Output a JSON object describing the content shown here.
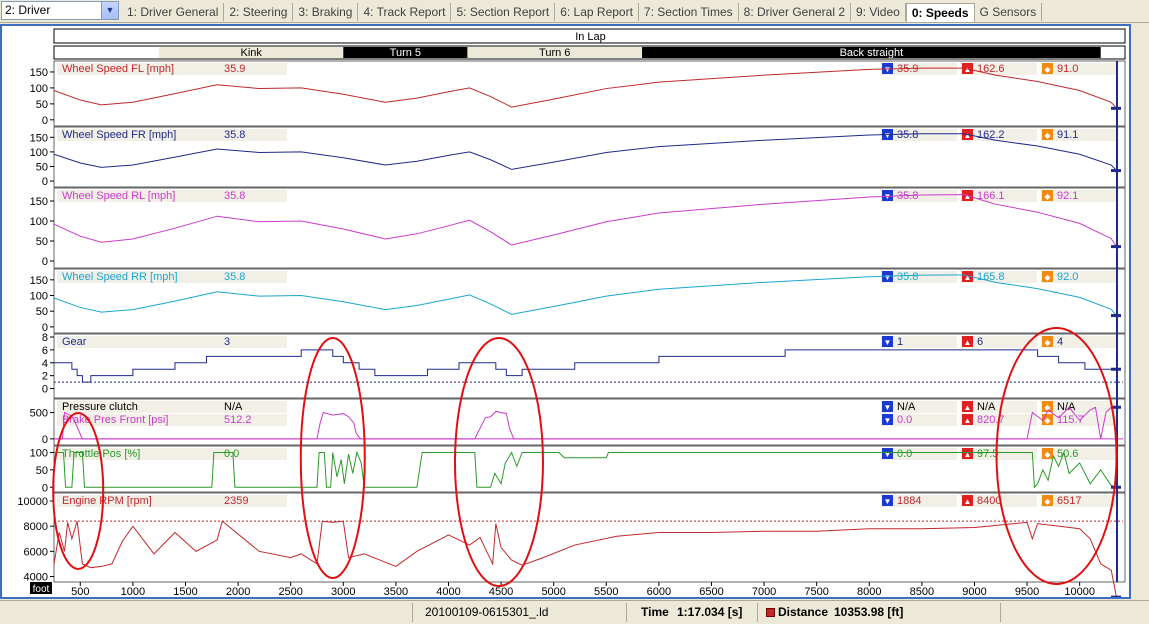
{
  "driver_select": {
    "value": "2: Driver"
  },
  "tabs": [
    {
      "label": "1: Driver General"
    },
    {
      "label": "2: Steering"
    },
    {
      "label": "3: Braking"
    },
    {
      "label": "4: Track Report"
    },
    {
      "label": "5: Section Report"
    },
    {
      "label": "6: Lap Report"
    },
    {
      "label": "7: Section Times"
    },
    {
      "label": "8: Driver General 2"
    },
    {
      "label": "9: Video"
    },
    {
      "label": "0: Speeds",
      "active": true
    },
    {
      "label": "G Sensors"
    }
  ],
  "lap_label": "In Lap",
  "sections": [
    {
      "label": "Kink",
      "dark": false,
      "from": 1250,
      "to": 3000
    },
    {
      "label": "Turn 5",
      "dark": true,
      "from": 3000,
      "to": 4180
    },
    {
      "label": "Turn 6",
      "dark": false,
      "from": 4180,
      "to": 5840
    },
    {
      "label": "Back straight",
      "dark": true,
      "from": 5840,
      "to": 10200
    }
  ],
  "colors": {
    "fl": "#c0282c",
    "fr": "#1f2a8c",
    "rl": "#cc3acc",
    "rr": "#1aa6d0",
    "gear": "#1f2a8c",
    "clutch": "#000000",
    "brake": "#cc3acc",
    "throttle": "#2a9a2a",
    "rpm": "#c0282c",
    "min_icon": "#1a3ad0",
    "max_icon": "#e02020",
    "avg_icon": "#f08a10",
    "cursor": "#1f2a8c",
    "ellipse": "#e01010",
    "frame": "#3c6fc4"
  },
  "panels": [
    {
      "key": "fl",
      "channels": [
        {
          "name": "Wheel Speed FL [mph]",
          "value": "35.9",
          "min": "35.9",
          "max": "162.6",
          "avg": "91.0"
        }
      ],
      "ticks": [
        "150",
        "100",
        "50",
        "0"
      ]
    },
    {
      "key": "fr",
      "channels": [
        {
          "name": "Wheel Speed FR [mph]",
          "value": "35.8",
          "min": "35.8",
          "max": "162.2",
          "avg": "91.1"
        }
      ],
      "ticks": [
        "150",
        "100",
        "50",
        "0"
      ]
    },
    {
      "key": "rl",
      "channels": [
        {
          "name": "Wheel Speed RL [mph]",
          "value": "35.8",
          "min": "35.8",
          "max": "166.1",
          "avg": "92.1"
        }
      ],
      "ticks": [
        "150",
        "100",
        "50",
        "0"
      ]
    },
    {
      "key": "rr",
      "channels": [
        {
          "name": "Wheel Speed RR [mph]",
          "value": "35.8",
          "min": "35.8",
          "max": "165.8",
          "avg": "92.0"
        }
      ],
      "ticks": [
        "150",
        "100",
        "50",
        "0"
      ]
    },
    {
      "key": "gear",
      "channels": [
        {
          "name": "Gear",
          "value": "3",
          "min": "1",
          "max": "6",
          "avg": "4"
        }
      ],
      "ticks": [
        "8",
        "6",
        "4",
        "2",
        "0"
      ]
    },
    {
      "key": "brake",
      "channels": [
        {
          "name": "Pressure clutch",
          "value": "N/A",
          "min": "N/A",
          "max": "N/A",
          "avg": "N/A",
          "color": "clutch"
        },
        {
          "name": "Brake Pres Front [psi]",
          "value": "512.2",
          "min": "0.0",
          "max": "820.7",
          "avg": "115.7",
          "color": "brake"
        }
      ],
      "ticks": [
        "500",
        "0"
      ]
    },
    {
      "key": "throttle",
      "channels": [
        {
          "name": "Throttle Pos [%]",
          "value": "0.0",
          "min": "0.0",
          "max": "97.5",
          "avg": "50.6"
        }
      ],
      "ticks": [
        "100",
        "50",
        "0"
      ]
    },
    {
      "key": "rpm",
      "channels": [
        {
          "name": "Engine RPM [rpm]",
          "value": "2359",
          "min": "1884",
          "max": "8400",
          "avg": "6517"
        }
      ],
      "ticks": [
        "10000",
        "8000",
        "6000",
        "4000"
      ]
    }
  ],
  "x_axis": {
    "unit_label": "foot",
    "ticks": [
      "500",
      "1000",
      "1500",
      "2000",
      "2500",
      "3000",
      "3500",
      "4000",
      "4500",
      "5000",
      "5500",
      "6000",
      "6500",
      "7000",
      "7500",
      "8000",
      "8500",
      "9000",
      "9500",
      "10000"
    ]
  },
  "status": {
    "filename": "20100109-0615301_.ld",
    "time_label": "Time",
    "time_value": "1:17.034 [s]",
    "distance_label": "Distance",
    "distance_value": "10353.98 [ft]"
  },
  "chart_data": {
    "type": "line",
    "xlabel": "foot",
    "xlim": [
      250,
      10450
    ],
    "series": [
      {
        "name": "Wheel Speed FL [mph]",
        "ylim": [
          -10,
          175
        ],
        "x": [
          250,
          500,
          700,
          1000,
          1400,
          1800,
          2200,
          2600,
          3000,
          3400,
          3700,
          4000,
          4200,
          4400,
          4600,
          5000,
          5500,
          6000,
          7000,
          8000,
          8500,
          8900,
          9200,
          9600,
          10000,
          10300,
          10350
        ],
        "y": [
          92,
          62,
          47,
          55,
          82,
          110,
          98,
          100,
          80,
          55,
          68,
          88,
          100,
          73,
          40,
          65,
          98,
          118,
          140,
          158,
          162,
          162,
          140,
          120,
          92,
          55,
          36
        ]
      },
      {
        "name": "Wheel Speed FR [mph]",
        "ylim": [
          -10,
          175
        ],
        "x": [
          250,
          500,
          700,
          1000,
          1400,
          1800,
          2200,
          2600,
          3000,
          3400,
          3700,
          4000,
          4200,
          4400,
          4600,
          5000,
          5500,
          6000,
          7000,
          8000,
          8500,
          8900,
          9200,
          9600,
          10000,
          10300,
          10350
        ],
        "y": [
          92,
          62,
          47,
          55,
          82,
          110,
          98,
          100,
          80,
          55,
          68,
          88,
          100,
          73,
          40,
          65,
          98,
          118,
          140,
          158,
          162,
          162,
          140,
          120,
          92,
          55,
          36
        ]
      },
      {
        "name": "Wheel Speed RL [mph]",
        "ylim": [
          -10,
          175
        ],
        "x": [
          250,
          500,
          700,
          1000,
          1400,
          1800,
          2200,
          2600,
          3000,
          3400,
          3700,
          4000,
          4200,
          4400,
          4600,
          5000,
          5500,
          6000,
          7000,
          8000,
          8500,
          8900,
          9200,
          9600,
          10000,
          10300,
          10350
        ],
        "y": [
          92,
          62,
          47,
          55,
          82,
          112,
          98,
          100,
          80,
          55,
          68,
          88,
          102,
          73,
          40,
          65,
          98,
          120,
          142,
          160,
          165,
          166,
          142,
          122,
          94,
          56,
          36
        ]
      },
      {
        "name": "Wheel Speed RR [mph]",
        "ylim": [
          -10,
          175
        ],
        "x": [
          250,
          500,
          700,
          1000,
          1400,
          1800,
          2200,
          2600,
          3000,
          3400,
          3700,
          4000,
          4200,
          4400,
          4600,
          5000,
          5500,
          6000,
          7000,
          8000,
          8500,
          8900,
          9200,
          9600,
          10000,
          10300,
          10350
        ],
        "y": [
          92,
          62,
          47,
          55,
          82,
          112,
          98,
          100,
          80,
          55,
          68,
          88,
          102,
          73,
          40,
          65,
          98,
          120,
          142,
          160,
          165,
          166,
          142,
          122,
          94,
          56,
          36
        ]
      },
      {
        "name": "Gear",
        "ylim": [
          -1,
          8
        ],
        "step": true,
        "x": [
          250,
          420,
          470,
          520,
          600,
          1000,
          1400,
          1700,
          2600,
          2900,
          3000,
          3150,
          3300,
          3800,
          4100,
          4450,
          4550,
          4700,
          5200,
          6000,
          7200,
          9600,
          9800,
          10050,
          10350
        ],
        "y": [
          4,
          3,
          2,
          1,
          2,
          3,
          4,
          5,
          6,
          5,
          4,
          3,
          2,
          3,
          4,
          3,
          2,
          3,
          4,
          5,
          6,
          5,
          4,
          3,
          3
        ]
      },
      {
        "name": "Brake Pres Front [psi]",
        "ylim": [
          -60,
          700
        ],
        "x": [
          250,
          330,
          350,
          420,
          450,
          480,
          510,
          520,
          2750,
          2780,
          2810,
          2900,
          3000,
          3050,
          3100,
          3120,
          3150,
          3170,
          3200,
          4250,
          4300,
          4350,
          4400,
          4450,
          4550,
          4580,
          4620,
          9500,
          9550,
          9650,
          9700,
          9800,
          9900,
          10000,
          10100,
          10150,
          10200,
          10250,
          10300
        ],
        "y": [
          0,
          0,
          500,
          430,
          320,
          180,
          40,
          0,
          0,
          300,
          500,
          450,
          480,
          420,
          300,
          120,
          30,
          0,
          0,
          0,
          200,
          400,
          420,
          520,
          480,
          200,
          0,
          0,
          500,
          350,
          550,
          400,
          600,
          350,
          550,
          600,
          0,
          500,
          600
        ]
      },
      {
        "name": "Throttle Pos [%]",
        "ylim": [
          -5,
          110
        ],
        "x": [
          250,
          340,
          360,
          420,
          440,
          520,
          540,
          1750,
          1770,
          1950,
          1970,
          2750,
          2770,
          2820,
          2840,
          2880,
          2900,
          2940,
          2980,
          3010,
          3050,
          3090,
          3130,
          3170,
          3200,
          3700,
          3750,
          4250,
          4270,
          4400,
          4440,
          4500,
          4540,
          4600,
          4650,
          4700,
          4750,
          5050,
          5100,
          5500,
          5520,
          9550,
          9570,
          9600,
          9650,
          9700,
          9750,
          9800,
          9850,
          9900,
          10000,
          10100,
          10200,
          10300,
          10350
        ],
        "y": [
          100,
          100,
          0,
          0,
          100,
          100,
          0,
          0,
          100,
          100,
          0,
          0,
          100,
          100,
          0,
          0,
          100,
          30,
          80,
          10,
          95,
          40,
          100,
          70,
          0,
          0,
          100,
          100,
          0,
          0,
          40,
          10,
          70,
          100,
          60,
          100,
          100,
          100,
          85,
          85,
          100,
          100,
          0,
          10,
          50,
          20,
          90,
          60,
          100,
          40,
          70,
          10,
          50,
          5,
          0
        ]
      },
      {
        "name": "Engine RPM [rpm]",
        "ylim": [
          3800,
          10400
        ],
        "x": [
          250,
          300,
          350,
          380,
          420,
          470,
          520,
          600,
          700,
          800,
          900,
          1000,
          1200,
          1400,
          1600,
          1800,
          1850,
          2200,
          2500,
          2600,
          2750,
          2800,
          2900,
          3000,
          3050,
          3200,
          3500,
          3700,
          4000,
          4200,
          4300,
          4420,
          4450,
          4500,
          4600,
          4700,
          4900,
          5200,
          5600,
          6000,
          6500,
          7000,
          7500,
          8000,
          8500,
          9000,
          9500,
          9550,
          9600,
          9800,
          10000,
          10100,
          10200,
          10300,
          10350
        ],
        "y": [
          5000,
          7500,
          6000,
          8300,
          7000,
          8400,
          5000,
          4700,
          4800,
          5000,
          6800,
          8000,
          5800,
          7500,
          6000,
          6900,
          8400,
          6000,
          5500,
          5800,
          5000,
          8400,
          8300,
          8400,
          5500,
          5800,
          4800,
          6000,
          7300,
          6500,
          7100,
          5000,
          8200,
          6300,
          5300,
          4900,
          5500,
          6500,
          7200,
          7500,
          7500,
          7600,
          7600,
          7800,
          7800,
          7900,
          8300,
          7000,
          8200,
          8000,
          7800,
          7000,
          5000,
          4500,
          2359
        ]
      }
    ]
  }
}
